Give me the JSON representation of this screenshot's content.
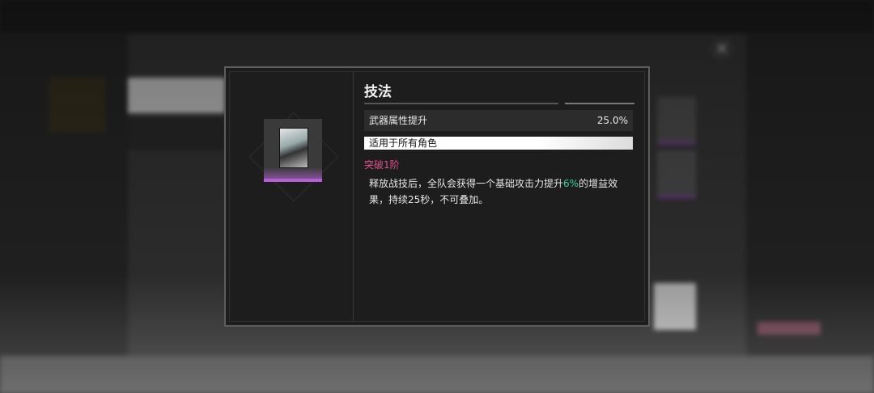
{
  "modal": {
    "title": "技法",
    "stat": {
      "label": "武器属性提升",
      "value": "25.0%"
    },
    "applicable": "适用于所有角色",
    "rank": "突破1阶",
    "description": {
      "before": "释放战技后，全队会获得一个基础攻击力提升",
      "highlight": "6%",
      "after": "的增益效果，持续25秒，不可叠加。"
    }
  },
  "colors": {
    "rank": "#e0508a",
    "highlight": "#3fd1a8",
    "rarity_bar": "#b45fd6"
  },
  "icons": {
    "close": "close-icon",
    "card": "weapon-card-art"
  }
}
